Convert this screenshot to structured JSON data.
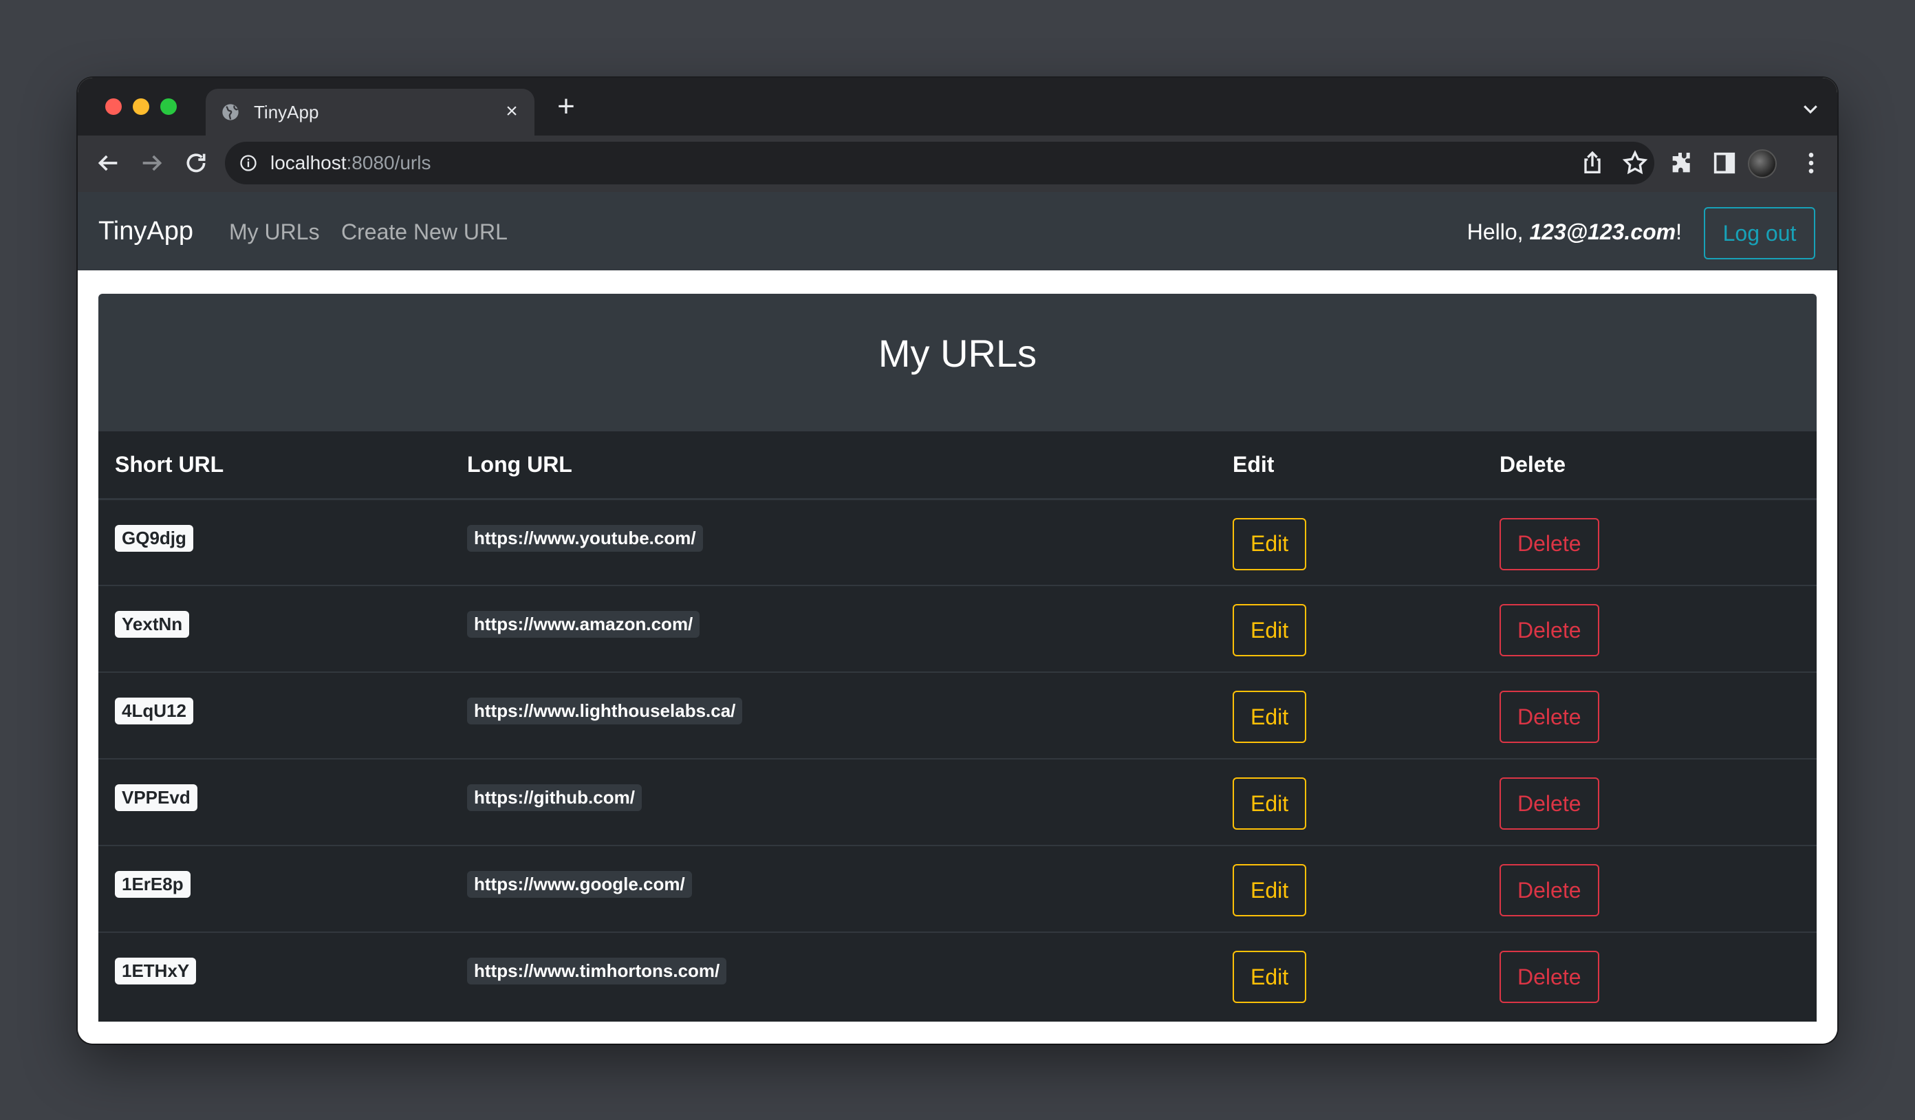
{
  "browser": {
    "tab_title": "TinyApp",
    "url_host": "localhost",
    "url_path": ":8080/urls"
  },
  "navbar": {
    "brand": "TinyApp",
    "links": [
      "My URLs",
      "Create New URL"
    ],
    "greeting_prefix": "Hello, ",
    "user_email": "123@123.com",
    "greeting_suffix": "!",
    "logout_label": "Log out"
  },
  "main": {
    "heading": "My URLs",
    "columns": [
      "Short URL",
      "Long URL",
      "Edit",
      "Delete"
    ],
    "rows": [
      {
        "short": "GQ9djg",
        "long": "https://www.youtube.com/",
        "edit": "Edit",
        "delete": "Delete"
      },
      {
        "short": "YextNn",
        "long": "https://www.amazon.com/",
        "edit": "Edit",
        "delete": "Delete"
      },
      {
        "short": "4LqU12",
        "long": "https://www.lighthouselabs.ca/",
        "edit": "Edit",
        "delete": "Delete"
      },
      {
        "short": "VPPEvd",
        "long": "https://github.com/",
        "edit": "Edit",
        "delete": "Delete"
      },
      {
        "short": "1ErE8p",
        "long": "https://www.google.com/",
        "edit": "Edit",
        "delete": "Delete"
      },
      {
        "short": "1ETHxY",
        "long": "https://www.timhortons.com/",
        "edit": "Edit",
        "delete": "Delete"
      }
    ]
  },
  "icons": [
    "globe-icon",
    "close-icon",
    "plus-icon",
    "chevron-down-icon",
    "back-arrow-icon",
    "forward-arrow-icon",
    "reload-icon",
    "info-icon",
    "share-icon",
    "star-icon",
    "extensions-icon",
    "side-panel-icon",
    "kebab-menu-icon"
  ],
  "colors": {
    "navbar_bg": "#343a40",
    "table_bg": "#212529",
    "logout": "#17a2b8",
    "edit": "#ffc107",
    "delete": "#dc3545"
  }
}
